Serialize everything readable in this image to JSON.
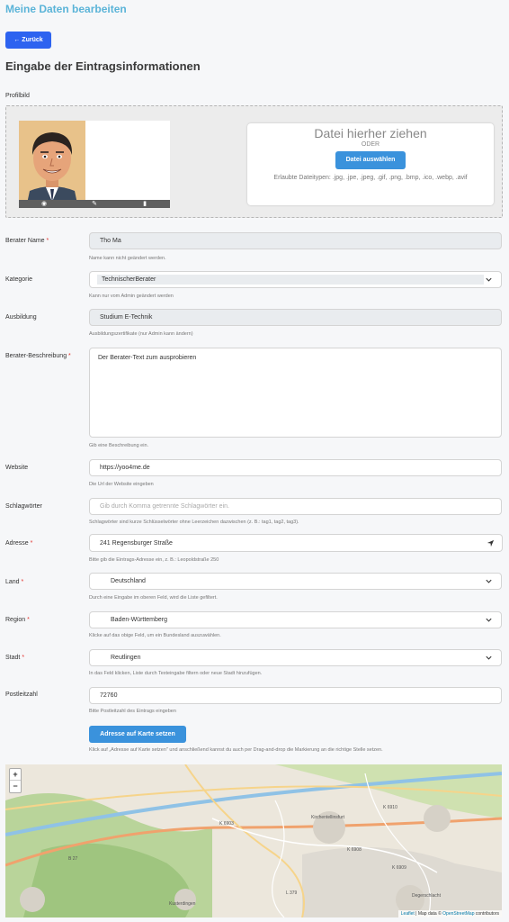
{
  "header": {
    "title": "Meine Daten bearbeiten",
    "back_label": "← Zurück"
  },
  "section_title": "Eingabe der Eintragsinformationen",
  "profilbild": {
    "label": "Profilbild",
    "drop_title": "Datei hierher ziehen",
    "drop_or": "ODER",
    "select_button": "Datei auswählen",
    "allowed_types": "Erlaubte Dateitypen: .jpg, .jpe, .jpeg, .gif, .png, .bmp, .ico, .webp, .avif"
  },
  "fields": {
    "berater_name": {
      "label": "Berater Name",
      "required": "*",
      "value": "Tho Ma",
      "help": "Name kann nicht geändert werden."
    },
    "kategorie": {
      "label": "Kategorie",
      "value": "TechnischerBerater",
      "help": "Kann nur vom Admin geändert werden"
    },
    "ausbildung": {
      "label": "Ausbildung",
      "value": "Studium E-Technik",
      "help": "Ausbildungszertifikate (nur Admin kann ändern)"
    },
    "beschreibung": {
      "label": "Berater-Beschreibung",
      "required": "*",
      "value": "Der Berater-Text zum ausprobieren",
      "help": "Gib eine Beschreibung ein."
    },
    "website": {
      "label": "Website",
      "value": "https://yoo4me.de",
      "help": "Die Url der Website eingeben"
    },
    "schlagwoerter": {
      "label": "Schlagwörter",
      "placeholder": "Gib durch Komma getrennte Schlagwörter ein.",
      "help": "Schlagwörter sind kurze Schlüsselwörter ohne Leerzeichen dazwischen (z. B.: tag1, tag2, tag3)."
    },
    "adresse": {
      "label": "Adresse",
      "required": "*",
      "value": "241 Regensburger Straße",
      "help": "Bitte gib die Eintrags-Adresse ein, z. B.: Leopoldstraße 250"
    },
    "land": {
      "label": "Land",
      "required": "*",
      "value": "Deutschland",
      "help": "Durch eine Eingabe im oberen Feld, wird die Liste gefiltert."
    },
    "region": {
      "label": "Region",
      "required": "*",
      "value": "Baden-Württemberg",
      "help": "Klicke auf das obige Feld, um ein Bundesland auszuwählen."
    },
    "stadt": {
      "label": "Stadt",
      "required": "*",
      "value": "Reutlingen",
      "help": "In das Feld klicken, Liste durch Texteingabe filtern oder neue Stadt hinzufügen."
    },
    "postleitzahl": {
      "label": "Postleitzahl",
      "value": "72760",
      "help": "Bitte Postleitzahl des Eintrags eingeben"
    }
  },
  "map": {
    "button_label": "Adresse auf Karte setzen",
    "instructions": "Klick auf „Adresse auf Karte setzen\" und anschließend kannst du auch per Drag-and-drop die Markierung an die richtige Stelle setzen.",
    "zoom_in": "+",
    "zoom_out": "−",
    "attribution_leaflet": "Leaflet",
    "attribution_text": " | Map data © ",
    "attribution_osm": "OpenStreetMap",
    "attribution_suffix": " contributors",
    "labels": [
      "K 6903",
      "K 6908",
      "K 6909",
      "K 6910",
      "B 27",
      "L 379",
      "Degerschlacht",
      "Kusterdingen",
      "Kirchentellinsfurt"
    ]
  },
  "colors": {
    "accent": "#3a92dc",
    "back_button": "#2d63f0",
    "title": "#5bb4d8",
    "required": "#e3342f"
  }
}
